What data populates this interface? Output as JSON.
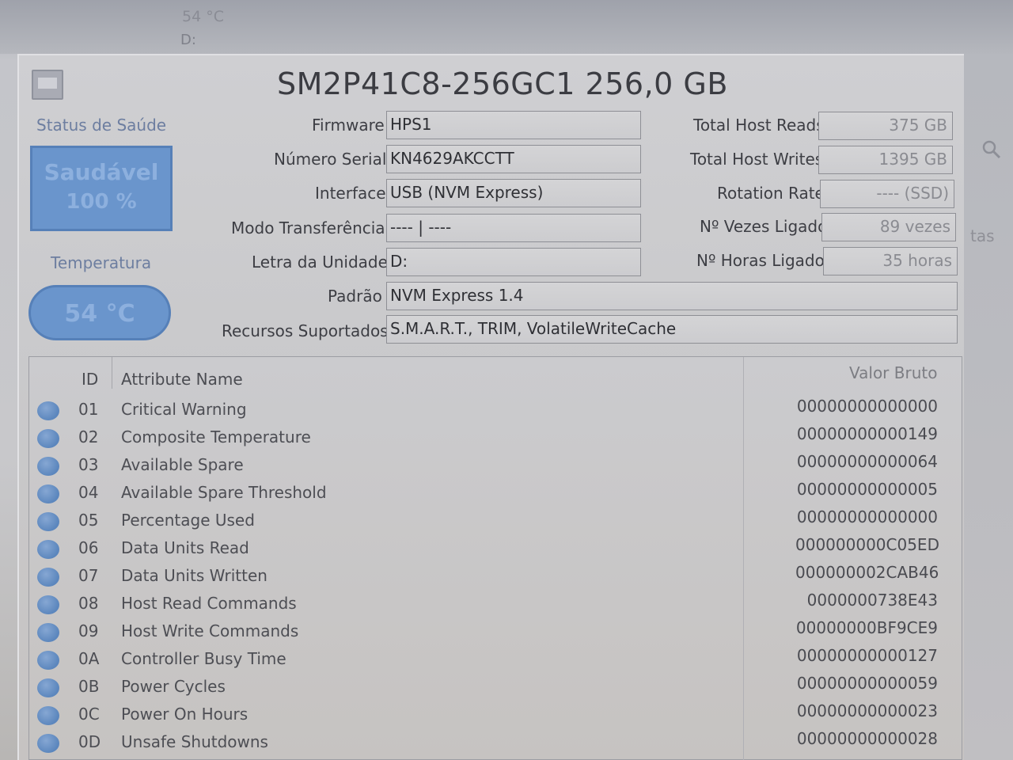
{
  "background": {
    "top_temp": "54 °C",
    "top_drive": "D:",
    "side_text": "tas"
  },
  "title": "SM2P41C8-256GC1 256,0 GB",
  "health": {
    "label": "Status de Saúde",
    "status": "Saudável",
    "percent": "100 %"
  },
  "temperature": {
    "label": "Temperatura",
    "value": "54 °C"
  },
  "details": {
    "firmware_label": "Firmware",
    "firmware": "HPS1",
    "serial_label": "Número Serial",
    "serial": "KN4629AKCCTT",
    "interface_label": "Interface",
    "interface": "USB (NVM Express)",
    "transfer_label": "Modo Transferência",
    "transfer": "---- | ----",
    "drive_letter_label": "Letra da Unidade",
    "drive_letter": "D:",
    "standard_label": "Padrão",
    "standard": "NVM Express 1.4",
    "features_label": "Recursos Suportados",
    "features": "S.M.A.R.T., TRIM, VolatileWriteCache"
  },
  "stats": {
    "reads_label": "Total Host Reads",
    "reads": "375 GB",
    "writes_label": "Total Host Writes",
    "writes": "1395 GB",
    "rotation_label": "Rotation Rate",
    "rotation": "---- (SSD)",
    "power_count_label": "Nº Vezes Ligado",
    "power_count": "89 vezes",
    "power_hours_label": "Nº Horas Ligado",
    "power_hours": "35 horas"
  },
  "table": {
    "headers": {
      "id": "ID",
      "name": "Attribute Name",
      "raw": "Valor Bruto"
    },
    "rows": [
      {
        "id": "01",
        "name": "Critical Warning",
        "raw": "00000000000000"
      },
      {
        "id": "02",
        "name": "Composite Temperature",
        "raw": "00000000000149"
      },
      {
        "id": "03",
        "name": "Available Spare",
        "raw": "00000000000064"
      },
      {
        "id": "04",
        "name": "Available Spare Threshold",
        "raw": "00000000000005"
      },
      {
        "id": "05",
        "name": "Percentage Used",
        "raw": "00000000000000"
      },
      {
        "id": "06",
        "name": "Data Units Read",
        "raw": "000000000C05ED"
      },
      {
        "id": "07",
        "name": "Data Units Written",
        "raw": "000000002CAB46"
      },
      {
        "id": "08",
        "name": "Host Read Commands",
        "raw": "0000000738E43"
      },
      {
        "id": "09",
        "name": "Host Write Commands",
        "raw": "00000000BF9CE9"
      },
      {
        "id": "0A",
        "name": "Controller Busy Time",
        "raw": "00000000000127"
      },
      {
        "id": "0B",
        "name": "Power Cycles",
        "raw": "00000000000059"
      },
      {
        "id": "0C",
        "name": "Power On Hours",
        "raw": "00000000000023"
      },
      {
        "id": "0D",
        "name": "Unsafe Shutdowns",
        "raw": "00000000000028"
      }
    ]
  }
}
